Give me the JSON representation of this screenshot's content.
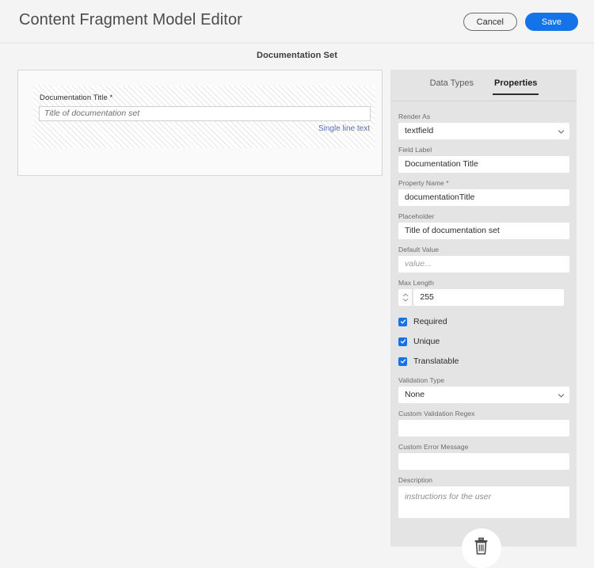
{
  "header": {
    "title": "Content Fragment Model Editor",
    "cancel_label": "Cancel",
    "save_label": "Save",
    "accent_color": "#1473e6"
  },
  "subtitle": "Documentation Set",
  "canvas": {
    "dropzone": {
      "field_label": "Documentation Title *",
      "input_placeholder": "Title of documentation set",
      "data_type_link": "Single line text"
    }
  },
  "panel": {
    "tabs": [
      {
        "label": "Data Types",
        "active": false
      },
      {
        "label": "Properties",
        "active": true
      }
    ],
    "fields": {
      "render_as": {
        "label": "Render As",
        "value": "textfield"
      },
      "field_label": {
        "label": "Field Label",
        "value": "Documentation Title"
      },
      "property_name": {
        "label": "Property Name *",
        "value": "documentationTitle"
      },
      "placeholder": {
        "label": "Placeholder",
        "value": "Title of documentation set"
      },
      "default_value": {
        "label": "Default Value",
        "placeholder": "value..."
      },
      "max_length": {
        "label": "Max Length",
        "value": "255"
      },
      "validation_type": {
        "label": "Validation Type",
        "value": "None"
      },
      "custom_validation_regex": {
        "label": "Custom Validation Regex",
        "value": ""
      },
      "custom_error_message": {
        "label": "Custom Error Message",
        "value": ""
      },
      "description": {
        "label": "Description",
        "placeholder": "instructions for the user"
      }
    },
    "checkboxes": [
      {
        "label": "Required",
        "checked": true
      },
      {
        "label": "Unique",
        "checked": true
      },
      {
        "label": "Translatable",
        "checked": true
      }
    ],
    "delete_icon": "trash-icon"
  }
}
